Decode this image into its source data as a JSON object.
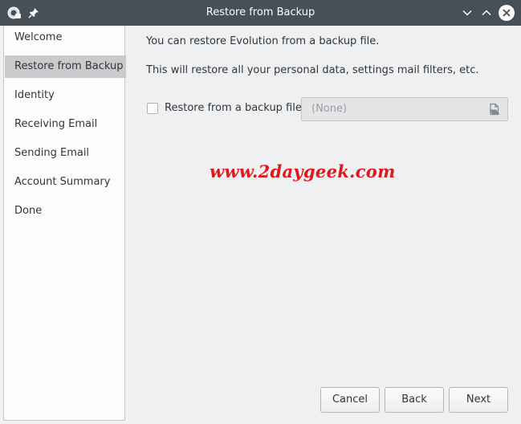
{
  "window": {
    "title": "Restore from Backup"
  },
  "sidebar": {
    "items": [
      {
        "label": "Welcome",
        "selected": false
      },
      {
        "label": "Restore from Backup",
        "selected": true
      },
      {
        "label": "Identity",
        "selected": false
      },
      {
        "label": "Receiving Email",
        "selected": false
      },
      {
        "label": "Sending Email",
        "selected": false
      },
      {
        "label": "Account Summary",
        "selected": false
      },
      {
        "label": "Done",
        "selected": false
      }
    ]
  },
  "main": {
    "intro_text": "You can restore Evolution from a backup file.",
    "detail_text": "This will restore all your personal data, settings mail filters, etc.",
    "restore_checkbox_label": "Restore from a backup file:",
    "restore_checkbox_checked": false,
    "file_chooser_value": "(None)",
    "watermark": "www.2daygeek.com"
  },
  "buttons": {
    "cancel": "Cancel",
    "back": "Back",
    "next": "Next"
  },
  "colors": {
    "titlebar": "#475057",
    "selected_item": "#c8cacc",
    "watermark": "#e0181e"
  },
  "icons": {
    "app": "evolution-app-icon",
    "pin": "pin-icon",
    "minimize": "chevron-down-icon",
    "maximize": "chevron-up-icon",
    "close": "close-icon",
    "file_open": "document-open-icon"
  }
}
